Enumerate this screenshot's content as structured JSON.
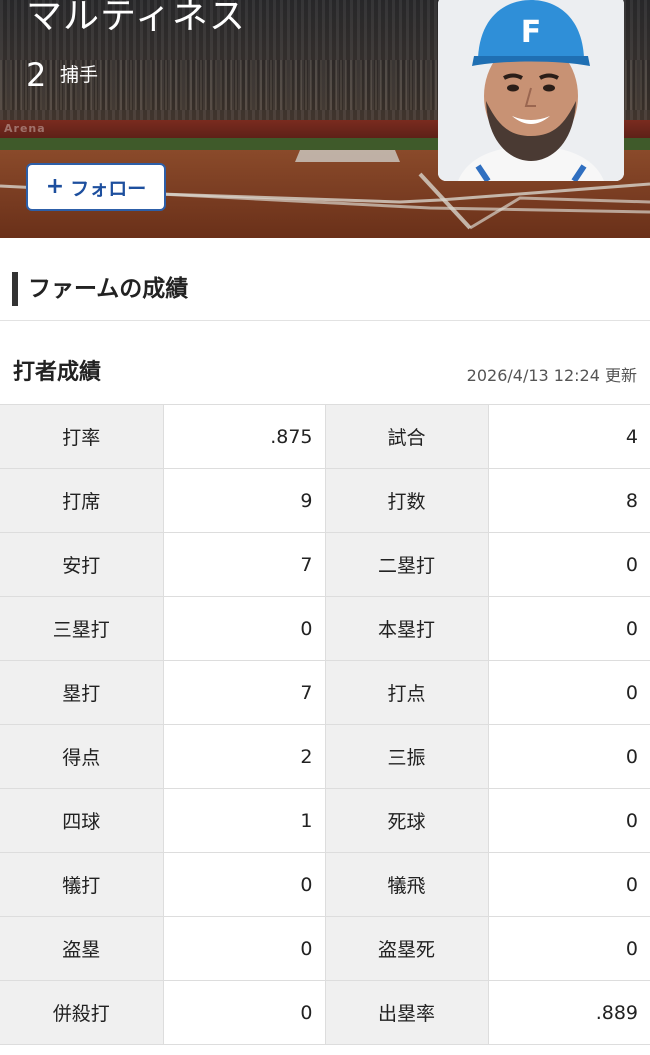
{
  "header": {
    "player_name": "マルティネス",
    "uniform_number": "2",
    "position": "捕手",
    "follow_label": "フォロー",
    "stadium_wall_text": "Arena"
  },
  "section": {
    "title": "ファームの成績"
  },
  "batting": {
    "title": "打者成績",
    "updated": "2026/4/13 12:24 更新",
    "rows": [
      {
        "label1": "打率",
        "value1": ".875",
        "label2": "試合",
        "value2": "4"
      },
      {
        "label1": "打席",
        "value1": "9",
        "label2": "打数",
        "value2": "8"
      },
      {
        "label1": "安打",
        "value1": "7",
        "label2": "二塁打",
        "value2": "0"
      },
      {
        "label1": "三塁打",
        "value1": "0",
        "label2": "本塁打",
        "value2": "0"
      },
      {
        "label1": "塁打",
        "value1": "7",
        "label2": "打点",
        "value2": "0"
      },
      {
        "label1": "得点",
        "value1": "2",
        "label2": "三振",
        "value2": "0"
      },
      {
        "label1": "四球",
        "value1": "1",
        "label2": "死球",
        "value2": "0"
      },
      {
        "label1": "犠打",
        "value1": "0",
        "label2": "犠飛",
        "value2": "0"
      },
      {
        "label1": "盗塁",
        "value1": "0",
        "label2": "盗塁死",
        "value2": "0"
      },
      {
        "label1": "併殺打",
        "value1": "0",
        "label2": "出塁率",
        "value2": ".889"
      }
    ]
  },
  "colors": {
    "accent": "#1d4f9e",
    "label_cell_bg": "#f0f0f0",
    "cap_blue": "#2f8fd8"
  },
  "icons": {
    "follow": "plus-icon",
    "cap_logo": "F"
  }
}
